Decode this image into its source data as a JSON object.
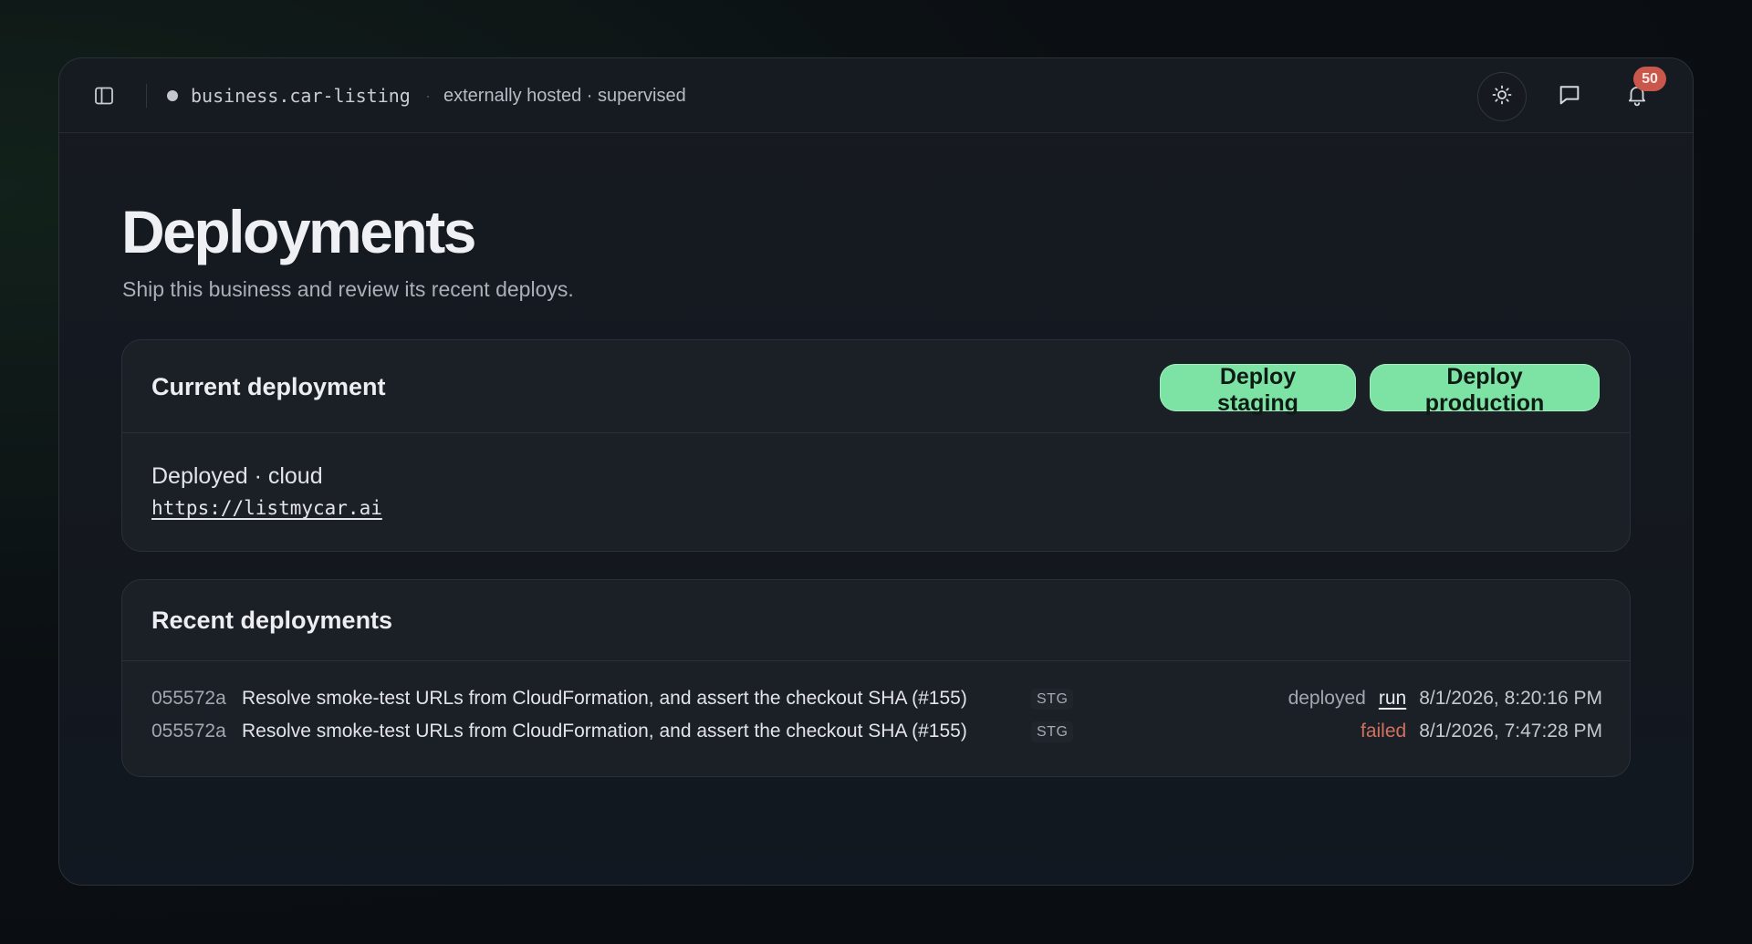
{
  "topbar": {
    "business_name": "business.car-listing",
    "separator": "·",
    "hosting": "externally hosted · supervised",
    "notifications_count": "50"
  },
  "page": {
    "title": "Deployments",
    "subtitle": "Ship this business and review its recent deploys."
  },
  "current": {
    "title": "Current deployment",
    "deploy_staging_label": "Deploy staging",
    "deploy_production_label": "Deploy production",
    "status": "Deployed · cloud",
    "url": "https://listmycar.ai"
  },
  "recent": {
    "title": "Recent deployments",
    "rows": [
      {
        "sha": "055572a",
        "message": "Resolve smoke-test URLs from CloudFormation, and assert the checkout SHA (#155)",
        "env": "STG",
        "state": "deployed",
        "run_label": "run",
        "time": "8/1/2026, 8:20:16 PM"
      },
      {
        "sha": "055572a",
        "message": "Resolve smoke-test URLs from CloudFormation, and assert the checkout SHA (#155)",
        "env": "STG",
        "state": "failed",
        "time": "8/1/2026, 7:47:28 PM"
      }
    ]
  },
  "icons": {
    "sidebar": "sidebar-toggle-icon",
    "theme": "sun-icon",
    "chat": "chat-bubble-icon",
    "bell": "bell-icon"
  },
  "colors": {
    "accent_green": "#7ce3a5",
    "failed": "#d1715f",
    "badge": "#c8584c"
  }
}
